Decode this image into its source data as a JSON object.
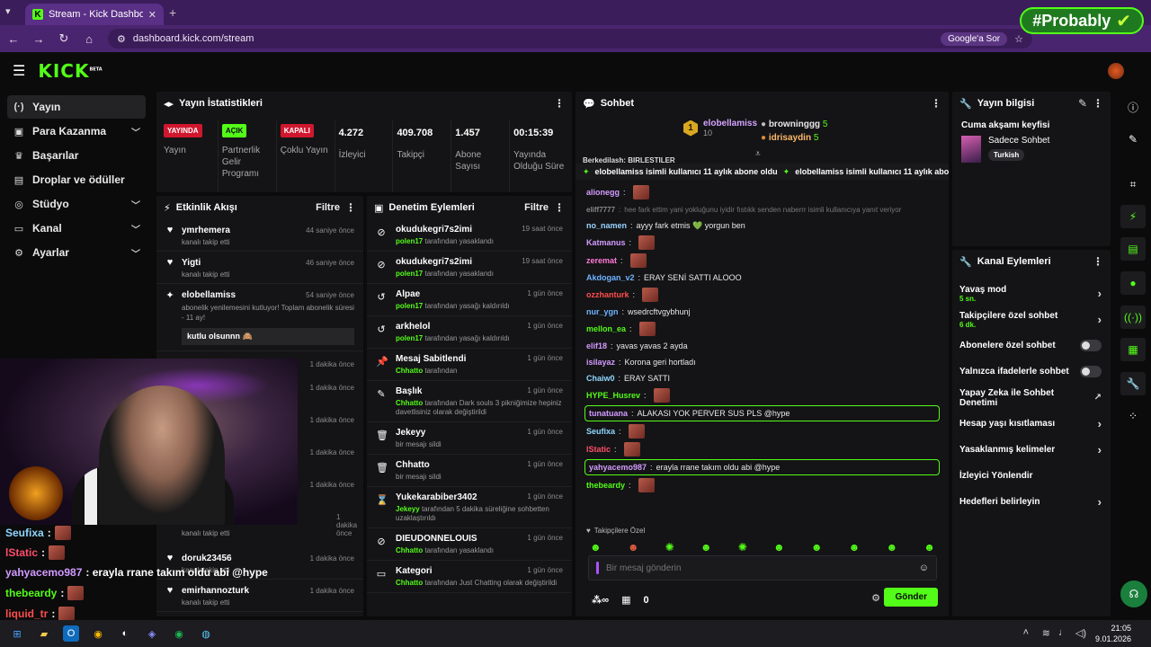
{
  "browser": {
    "tab_title": "Stream - Kick Dashboard",
    "url": "dashboard.kick.com/stream",
    "google_btn": "Google'a Sor",
    "overlay_brand": "#Probably"
  },
  "brand": {
    "logo": "KICK",
    "beta": "BETA"
  },
  "nav": [
    {
      "label": "Yayın",
      "icon": "broadcast-icon"
    },
    {
      "label": "Para Kazanma",
      "icon": "money-icon"
    },
    {
      "label": "Başarılar",
      "icon": "trophy-icon"
    },
    {
      "label": "Droplar ve ödüller",
      "icon": "gift-icon"
    },
    {
      "label": "Stüdyo",
      "icon": "studio-icon"
    },
    {
      "label": "Kanal",
      "icon": "channel-icon"
    },
    {
      "label": "Ayarlar",
      "icon": "settings-icon"
    }
  ],
  "stats": {
    "title": "Yayın İstatistikleri",
    "items": [
      {
        "value": "YAYINDA",
        "label": "Yayın",
        "style": "red"
      },
      {
        "value": "AÇIK",
        "label": "Partnerlik Gelir Programı",
        "style": "green"
      },
      {
        "value": "KAPALI",
        "label": "Çoklu Yayın",
        "style": "red"
      },
      {
        "value": "4.272",
        "label": "İzleyici"
      },
      {
        "value": "409.708",
        "label": "Takipçi"
      },
      {
        "value": "1.457",
        "label": "Abone Sayısı"
      },
      {
        "value": "00:15:39",
        "label": "Yayında Olduğu Süre"
      }
    ]
  },
  "activity": {
    "title": "Etkinlik Akışı",
    "filter": "Filtre",
    "items": [
      {
        "name": "ymrhemera",
        "time": "44 saniye önce",
        "sub": "kanalı takip etti"
      },
      {
        "name": "Yigti",
        "time": "46 saniye önce",
        "sub": "kanalı takip etti"
      },
      {
        "name": "elobellamiss",
        "time": "54 saniye önce",
        "sub": "abonelik yenilemesini kutluyor! Toplam abonelik süresi - 11 ay!",
        "msg": "kutlu olsunnn 🙈"
      }
    ],
    "bottom_items": [
      {
        "name": "doruk23456",
        "time": "1 dakika önce",
        "sub": "kanalı takip etti"
      },
      {
        "name": "emirhannozturk",
        "time": "1 dakika önce",
        "sub": "kanalı takip etti"
      }
    ],
    "hidden_times": [
      "1 dakika önce",
      "1 dakika önce",
      "1 dakika önce",
      "1 dakika önce",
      "1 dakika önce",
      "1 dakika önce",
      "1 dakika önce"
    ],
    "visible_sub": "kanalı takip etti"
  },
  "moderation": {
    "title": "Denetim Eylemleri",
    "filter": "Filtre",
    "items": [
      {
        "icon": "ban-icon",
        "name": "okudukegri7s2imi",
        "time": "19 saat önce",
        "actor": "polen17",
        "text": "tarafından yasaklandı"
      },
      {
        "icon": "ban-icon",
        "name": "okudukegri7s2imi",
        "time": "19 saat önce",
        "actor": "polen17",
        "text": "tarafından yasaklandı"
      },
      {
        "icon": "undo-icon",
        "name": "Alpae",
        "time": "1 gün önce",
        "actor": "polen17",
        "text": "tarafından yasağı kaldırıldı"
      },
      {
        "icon": "undo-icon",
        "name": "arkhelol",
        "time": "1 gün önce",
        "actor": "polen17",
        "text": "tarafından yasağı kaldırıldı"
      },
      {
        "icon": "pin-icon",
        "name": "Mesaj Sabitlendi",
        "time": "1 gün önce",
        "actor": "Chhatto",
        "text": "tarafından"
      },
      {
        "icon": "edit-icon",
        "name": "Başlık",
        "time": "1 gün önce",
        "actor": "Chhatto",
        "text": "tarafından Dark souls 3 pikniğimize hepiniz davetlisiniz olarak değiştirildi"
      },
      {
        "icon": "trash-icon",
        "name": "Jekeyy",
        "time": "1 gün önce",
        "actor": "",
        "text": "bir mesajı sildi"
      },
      {
        "icon": "trash-icon",
        "name": "Chhatto",
        "time": "1 gün önce",
        "actor": "",
        "text": "bir mesajı sildi"
      },
      {
        "icon": "hourglass-icon",
        "name": "Yukekarabiber3402",
        "time": "1 gün önce",
        "actor": "Jekeyy",
        "text": "tarafından 5 dakika süreliğine sohbetten uzaklaştırıldı"
      },
      {
        "icon": "ban-icon",
        "name": "DIEUDONNELOUIS",
        "time": "1 gün önce",
        "actor": "Chhatto",
        "text": "tarafından yasaklandı"
      },
      {
        "icon": "category-icon",
        "name": "Kategori",
        "time": "1 gün önce",
        "actor": "Chhatto",
        "text": "tarafından Just Chatting olarak değiştirildi"
      }
    ]
  },
  "chat": {
    "title": "Sohbet",
    "leaderboard": [
      {
        "rank": "1",
        "name": "elobellamiss",
        "count": "10"
      },
      {
        "name": "browninggg",
        "count": "5"
      },
      {
        "name": "idrisaydin",
        "count": "5"
      }
    ],
    "sub_banner": "elobellamiss isimli kullanıcı 11 aylık abone oldu",
    "top_cut": "Berkedilash: BIRLESTILER",
    "messages": [
      {
        "user": "alionegg",
        "color": "#d39bff",
        "text": "",
        "emote": true
      },
      {
        "user": "eliff7777",
        "color": "#888888",
        "text": "hee fark ettim yani yokluğunu iyidir fıstıkk senden naberrr isimli kullanıcıya yanıt veriyor",
        "faded": true
      },
      {
        "user": "no_namen",
        "color": "#9ad4ff",
        "text": "ayyy fark etmis 💚 yorgun ben"
      },
      {
        "user": "Katmanus",
        "color": "#d39bff",
        "text": "",
        "emote": true
      },
      {
        "user": "zeremat",
        "color": "#ff7ad9",
        "text": "",
        "emote": true
      },
      {
        "user": "Akdogan_v2",
        "color": "#6fb3ff",
        "text": "ERAY SENİ SATTI ALOOO"
      },
      {
        "user": "ozzhanturk",
        "color": "#ff4d4d",
        "text": "",
        "emote": true
      },
      {
        "user": "nur_ygn",
        "color": "#6fb3ff",
        "text": "wsedrcftvgybhunj"
      },
      {
        "user": "mellon_ea",
        "color": "#53fc18",
        "text": "",
        "emote": true
      },
      {
        "user": "elif18",
        "color": "#d39bff",
        "text": "yavas yavas 2 ayda"
      },
      {
        "user": "isilayaz",
        "color": "#d39bff",
        "text": "Korona geri hortladı"
      },
      {
        "user": "Chaiw0",
        "color": "#8fd7ff",
        "text": "ERAY SATTI"
      },
      {
        "user": "HYPE_Husrev",
        "color": "#53fc18",
        "text": "",
        "emote": true
      },
      {
        "user": "tunatuana",
        "color": "#d39bff",
        "text": "ALAKASI YOK PERVER SUS PLS @hype",
        "highlight": true
      },
      {
        "user": "Seufixa",
        "color": "#8fd7ff",
        "text": "",
        "emote": true
      },
      {
        "user": "lStatic",
        "color": "#ff4d6a",
        "text": "",
        "emote": true
      },
      {
        "user": "yahyacemo987",
        "color": "#d39bff",
        "text": "erayla rrane takım oldu abi @hype",
        "highlight": true
      },
      {
        "user": "thebeardy",
        "color": "#53fc18",
        "text": "",
        "emote": true
      }
    ],
    "followers_only": "Takipçilere Özel",
    "input_placeholder": "Bir mesaj gönderin",
    "points": "0",
    "send_label": "Gönder"
  },
  "stream_info": {
    "title": "Yayın bilgisi",
    "stream_title": "Cuma akşamı keyfisi",
    "category": "Sadece Sohbet",
    "tag": "Turkish"
  },
  "channel_actions": {
    "title": "Kanal Eylemleri",
    "items": [
      {
        "label": "Yavaş mod",
        "sub": "5 sn.",
        "control": "arrow"
      },
      {
        "label": "Takipçilere özel sohbet",
        "sub": "6 dk.",
        "control": "arrow"
      },
      {
        "label": "Abonelere özel sohbet",
        "control": "toggle"
      },
      {
        "label": "Yalnızca ifadelerle sohbet",
        "control": "toggle"
      },
      {
        "label": "Yapay Zeka ile Sohbet Denetimi",
        "control": "external"
      },
      {
        "label": "Hesap yaşı kısıtlaması",
        "control": "arrow"
      },
      {
        "label": "Yasaklanmış kelimeler",
        "control": "arrow"
      },
      {
        "label": "İzleyici Yönlendir",
        "control": "none"
      },
      {
        "label": "Hedefleri belirleyin",
        "control": "arrow"
      }
    ]
  },
  "stream_overlay_chat": [
    {
      "user": "Seufixa",
      "color": "#8fd7ff",
      "text": ":",
      "emote": true
    },
    {
      "user": "lStatic",
      "color": "#ff4d6a",
      "text": ":",
      "emote": true
    },
    {
      "user": "yahyacemo987",
      "color": "#d39bff",
      "text": ": erayla rrane takım oldu abi @hype"
    },
    {
      "user": "thebeardy",
      "color": "#53fc18",
      "text": ":",
      "emote": true
    },
    {
      "user": "liquid_tr",
      "color": "#ff4d4d",
      "text": ":",
      "emote": true
    }
  ],
  "taskbar": {
    "time": "21:05",
    "date": "9.01.2026"
  }
}
